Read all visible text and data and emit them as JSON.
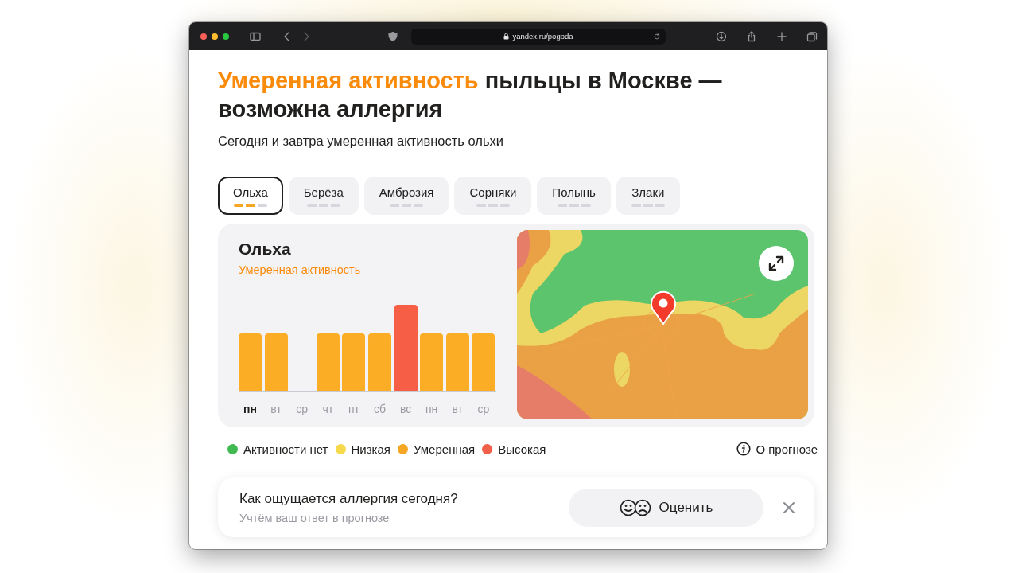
{
  "browser": {
    "url": "yandex.ru/pogoda"
  },
  "heading": {
    "accent": "Умеренная активность",
    "rest": "пыльцы в Москве — возможна аллергия"
  },
  "subtitle": "Сегодня и завтра умеренная активность ольхи",
  "tabs": [
    {
      "label": "Ольха",
      "selected": true,
      "level": 0.67
    },
    {
      "label": "Берёза",
      "selected": false,
      "level": 0
    },
    {
      "label": "Амброзия",
      "selected": false,
      "level": 0
    },
    {
      "label": "Сорняки",
      "selected": false,
      "level": 0
    },
    {
      "label": "Полынь",
      "selected": false,
      "level": 0
    },
    {
      "label": "Злаки",
      "selected": false,
      "level": 0
    }
  ],
  "plant": {
    "name": "Ольха",
    "status": "Умеренная активность"
  },
  "days": [
    {
      "label": "пн",
      "selected": true,
      "kind": "moderate"
    },
    {
      "label": "вт",
      "selected": false,
      "kind": "moderate"
    },
    {
      "label": "ср",
      "selected": false,
      "kind": "none"
    },
    {
      "label": "чт",
      "selected": false,
      "kind": "moderate"
    },
    {
      "label": "пт",
      "selected": false,
      "kind": "moderate"
    },
    {
      "label": "сб",
      "selected": false,
      "kind": "moderate"
    },
    {
      "label": "вс",
      "selected": false,
      "kind": "high"
    },
    {
      "label": "пн",
      "selected": false,
      "kind": "moderate"
    },
    {
      "label": "вт",
      "selected": false,
      "kind": "moderate"
    },
    {
      "label": "ср",
      "selected": false,
      "kind": "moderate"
    }
  ],
  "legend": [
    {
      "label": "Активности нет",
      "color": "#3fb950"
    },
    {
      "label": "Низкая",
      "color": "#f7d94c"
    },
    {
      "label": "Умеренная",
      "color": "#f5a623"
    },
    {
      "label": "Высокая",
      "color": "#f2604a"
    }
  ],
  "forecast_link": "О прогнозе",
  "feedback": {
    "question": "Как ощущается аллергия сегодня?",
    "hint": "Учтём ваш ответ в прогнозе",
    "button": "Оценить"
  }
}
